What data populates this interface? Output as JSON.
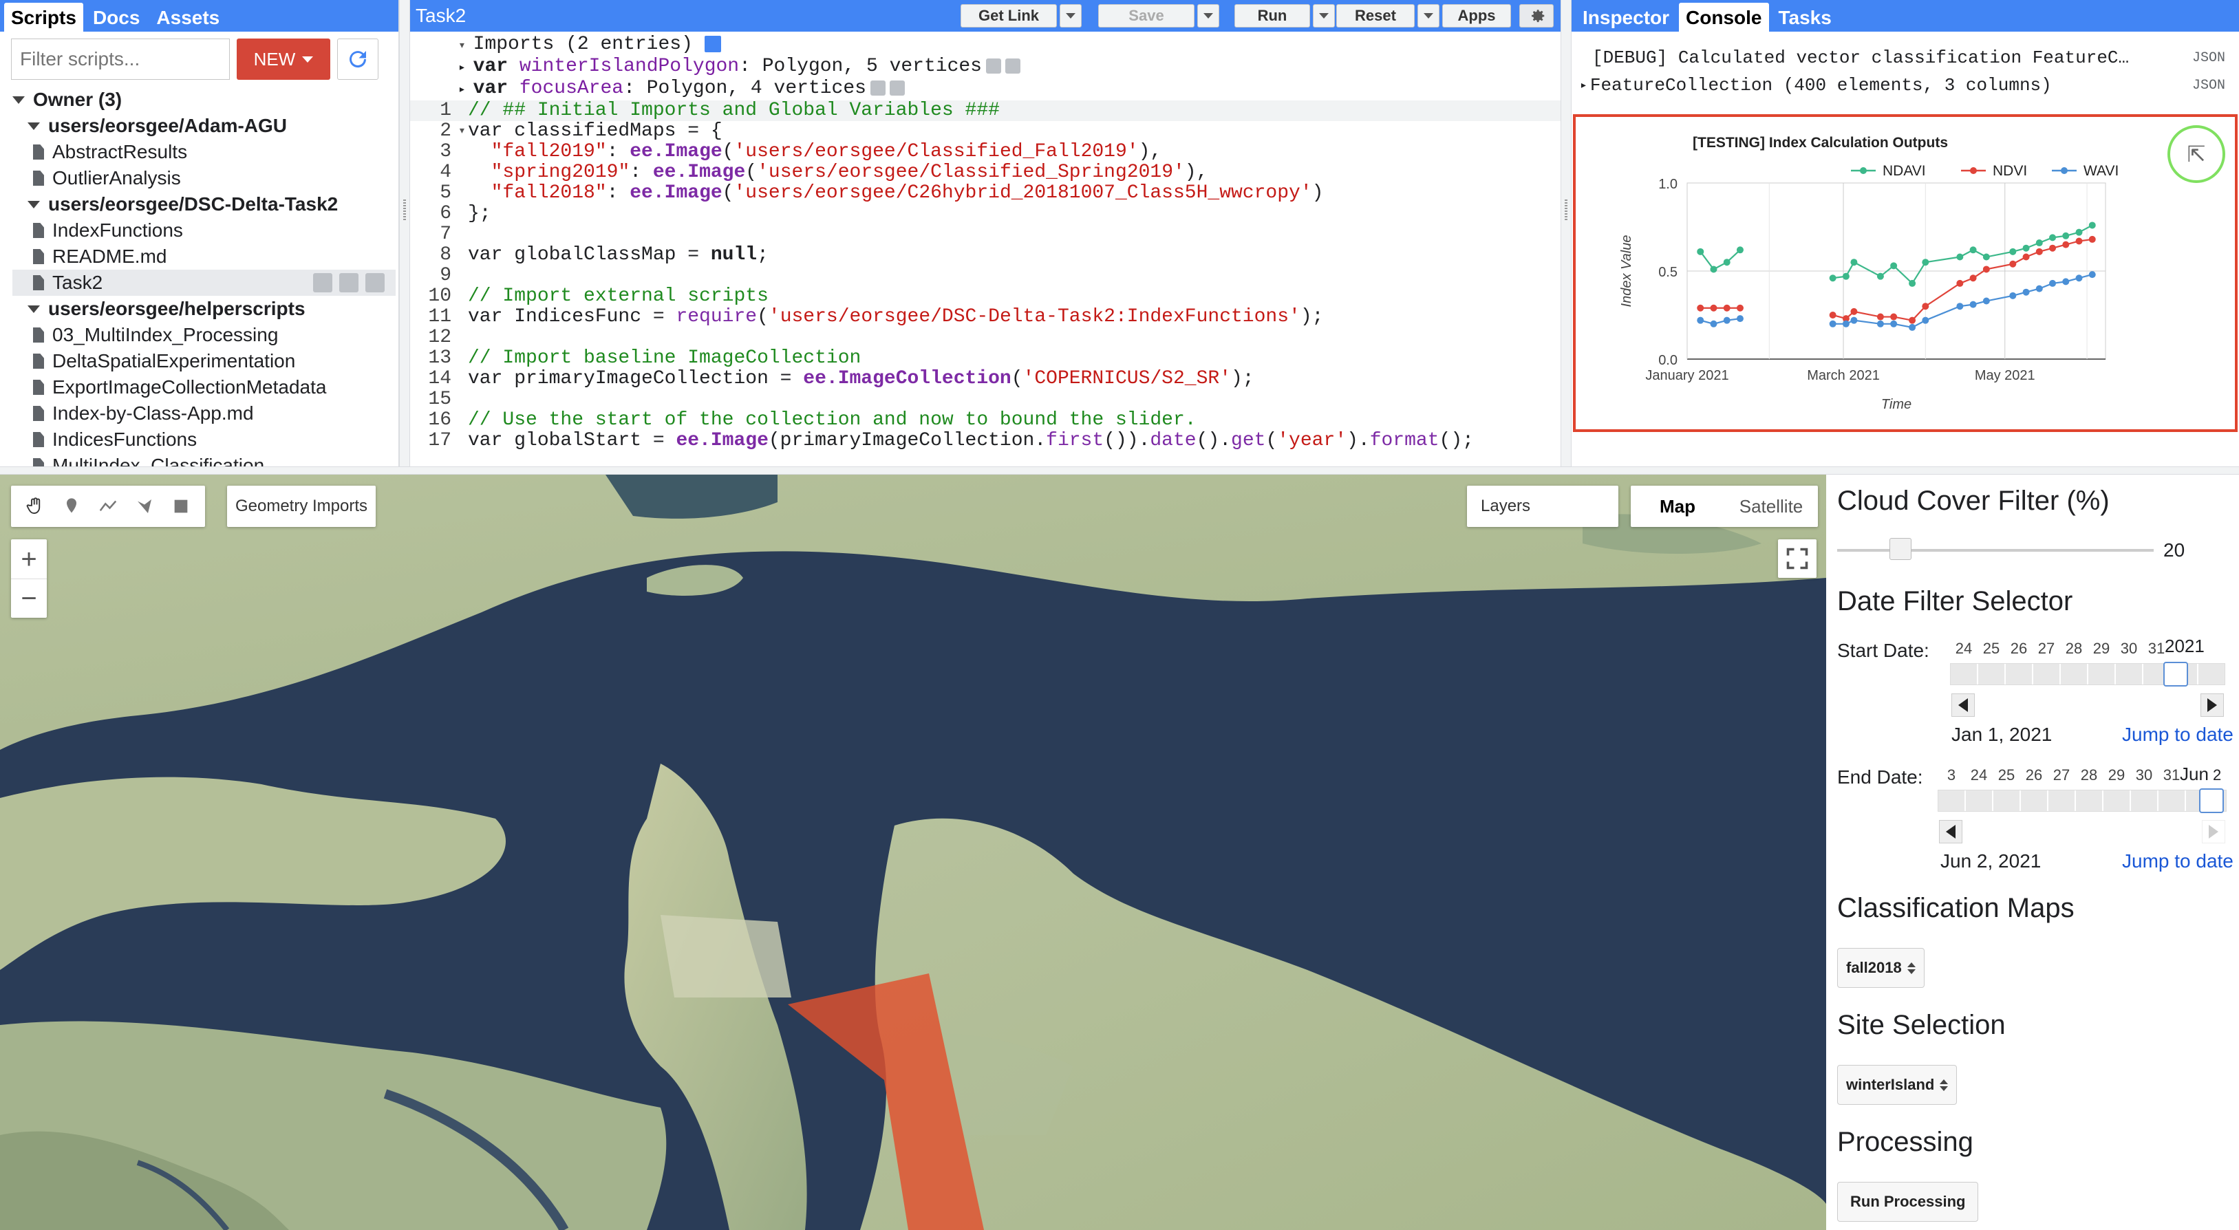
{
  "left_panel": {
    "tabs": [
      "Scripts",
      "Docs",
      "Assets"
    ],
    "filter_placeholder": "Filter scripts...",
    "new_label": "NEW",
    "tree": [
      {
        "label": "Owner (3)",
        "type": "root"
      },
      {
        "label": "users/eorsgee/Adam-AGU",
        "type": "folder"
      },
      {
        "label": "AbstractResults",
        "type": "file"
      },
      {
        "label": "OutlierAnalysis",
        "type": "file"
      },
      {
        "label": "users/eorsgee/DSC-Delta-Task2",
        "type": "folder"
      },
      {
        "label": "IndexFunctions",
        "type": "file"
      },
      {
        "label": "README.md",
        "type": "file"
      },
      {
        "label": "Task2",
        "type": "file",
        "selected": true
      },
      {
        "label": "users/eorsgee/helperscripts",
        "type": "folder"
      },
      {
        "label": "03_MultiIndex_Processing",
        "type": "file"
      },
      {
        "label": "DeltaSpatialExperimentation",
        "type": "file"
      },
      {
        "label": "ExportImageCollectionMetadata",
        "type": "file"
      },
      {
        "label": "Index-by-Class-App.md",
        "type": "file"
      },
      {
        "label": "IndicesFunctions",
        "type": "file"
      },
      {
        "label": "MultiIndex_Classification",
        "type": "file"
      }
    ]
  },
  "editor": {
    "title": "Task2",
    "buttons": {
      "get_link": "Get Link",
      "save": "Save",
      "run": "Run",
      "reset": "Reset",
      "apps": "Apps"
    },
    "imports_header": "Imports (2 entries)",
    "imports": [
      {
        "name": "winterIslandPolygon",
        "desc": "Polygon, 5 vertices"
      },
      {
        "name": "focusArea",
        "desc": "Polygon, 4 vertices"
      }
    ],
    "lines": [
      {
        "n": "1",
        "text": "// ## Initial Imports and Global Variables ###"
      },
      {
        "n": "2",
        "text": "var classifiedMaps = {"
      },
      {
        "n": "3",
        "text": "  \"fall2019\": ee.Image('users/eorsgee/Classified_Fall2019'),"
      },
      {
        "n": "4",
        "text": "  \"spring2019\": ee.Image('users/eorsgee/Classified_Spring2019'),"
      },
      {
        "n": "5",
        "text": "  \"fall2018\": ee.Image('users/eorsgee/C26hybrid_20181007_Class5H_wwcropy')"
      },
      {
        "n": "6",
        "text": "};"
      },
      {
        "n": "7",
        "text": ""
      },
      {
        "n": "8",
        "text": "var globalClassMap = null;"
      },
      {
        "n": "9",
        "text": ""
      },
      {
        "n": "10",
        "text": "// Import external scripts"
      },
      {
        "n": "11",
        "text": "var IndicesFunc = require('users/eorsgee/DSC-Delta-Task2:IndexFunctions');"
      },
      {
        "n": "12",
        "text": ""
      },
      {
        "n": "13",
        "text": "// Import baseline ImageCollection"
      },
      {
        "n": "14",
        "text": "var primaryImageCollection = ee.ImageCollection('COPERNICUS/S2_SR');"
      },
      {
        "n": "15",
        "text": ""
      },
      {
        "n": "16",
        "text": "// Use the start of the collection and now to bound the slider."
      },
      {
        "n": "17",
        "text": "var globalStart = ee.Image(primaryImageCollection.first()).date().get('year').format();"
      }
    ]
  },
  "right_panel": {
    "tabs": [
      "Inspector",
      "Console",
      "Tasks"
    ],
    "console": [
      {
        "text": "[DEBUG] Calculated vector classification FeatureC…",
        "tag": "JSON"
      },
      {
        "text": "FeatureCollection (400 elements, 3 columns)",
        "tag": "JSON"
      }
    ]
  },
  "chart_data": {
    "type": "line",
    "title": "[TESTING] Index Calculation Outputs",
    "xlabel": "Time",
    "ylabel": "Index Value",
    "ylim": [
      0.0,
      1.0
    ],
    "yticks": [
      "0.0",
      "0.5",
      "1.0"
    ],
    "xticks": [
      "January 2021",
      "March 2021",
      "May 2021"
    ],
    "legend_position": "top",
    "grid": true,
    "series": [
      {
        "name": "NDAVI",
        "color": "#3cb88a",
        "x": [
          "2021-01-06",
          "2021-01-11",
          "2021-01-16",
          "2021-01-21",
          "2021-02-25",
          "2021-03-02",
          "2021-03-05",
          "2021-03-15",
          "2021-03-20",
          "2021-03-27",
          "2021-04-01",
          "2021-04-14",
          "2021-04-19",
          "2021-04-24",
          "2021-05-04",
          "2021-05-09",
          "2021-05-14",
          "2021-05-19",
          "2021-05-24",
          "2021-05-29",
          "2021-06-03"
        ],
        "values": [
          0.61,
          0.51,
          0.55,
          0.62,
          0.46,
          0.47,
          0.55,
          0.47,
          0.53,
          0.43,
          0.55,
          0.58,
          0.62,
          0.58,
          0.61,
          0.63,
          0.66,
          0.69,
          0.7,
          0.72,
          0.76
        ]
      },
      {
        "name": "NDVI",
        "color": "#e0443a",
        "x": [
          "2021-01-06",
          "2021-01-11",
          "2021-01-16",
          "2021-01-21",
          "2021-02-25",
          "2021-03-02",
          "2021-03-05",
          "2021-03-15",
          "2021-03-20",
          "2021-03-27",
          "2021-04-01",
          "2021-04-14",
          "2021-04-19",
          "2021-04-24",
          "2021-05-04",
          "2021-05-09",
          "2021-05-14",
          "2021-05-19",
          "2021-05-24",
          "2021-05-29",
          "2021-06-03"
        ],
        "values": [
          0.29,
          0.29,
          0.29,
          0.29,
          0.25,
          0.23,
          0.27,
          0.24,
          0.24,
          0.22,
          0.3,
          0.43,
          0.46,
          0.51,
          0.54,
          0.58,
          0.61,
          0.63,
          0.65,
          0.67,
          0.68
        ]
      },
      {
        "name": "WAVI",
        "color": "#4a8fd6",
        "x": [
          "2021-01-06",
          "2021-01-11",
          "2021-01-16",
          "2021-01-21",
          "2021-02-25",
          "2021-03-02",
          "2021-03-05",
          "2021-03-15",
          "2021-03-20",
          "2021-03-27",
          "2021-04-01",
          "2021-04-14",
          "2021-04-19",
          "2021-04-24",
          "2021-05-04",
          "2021-05-09",
          "2021-05-14",
          "2021-05-19",
          "2021-05-24",
          "2021-05-29",
          "2021-06-03"
        ],
        "values": [
          0.22,
          0.2,
          0.22,
          0.23,
          0.2,
          0.2,
          0.22,
          0.2,
          0.2,
          0.18,
          0.22,
          0.3,
          0.31,
          0.33,
          0.36,
          0.38,
          0.4,
          0.43,
          0.44,
          0.46,
          0.48
        ]
      }
    ]
  },
  "map": {
    "geometry_imports": "Geometry Imports",
    "layers": "Layers",
    "map_type": [
      "Map",
      "Satellite"
    ],
    "active_map_type": "Map",
    "zoom_in": "+",
    "zoom_out": "−"
  },
  "ui_panel": {
    "cloud_title": "Cloud Cover Filter (%)",
    "cloud_value": "20",
    "cloud_fraction": 0.2,
    "date_title": "Date Filter Selector",
    "start_label": "Start Date:",
    "start_ticks": [
      "24",
      "25",
      "26",
      "27",
      "28",
      "29",
      "30",
      "31"
    ],
    "start_year": "2021",
    "start_value": "Jan 1, 2021",
    "end_label": "End Date:",
    "end_ticks": [
      "3",
      "24",
      "25",
      "26",
      "27",
      "28",
      "29",
      "30",
      "31"
    ],
    "end_month": "Jun",
    "end_day": "2",
    "end_value": "Jun 2, 2021",
    "jump_label": "Jump to date",
    "class_title": "Classification Maps",
    "class_selected": "fall2018",
    "site_title": "Site Selection",
    "site_selected": "winterIsland",
    "processing_title": "Processing",
    "run_label": "Run Processing"
  }
}
